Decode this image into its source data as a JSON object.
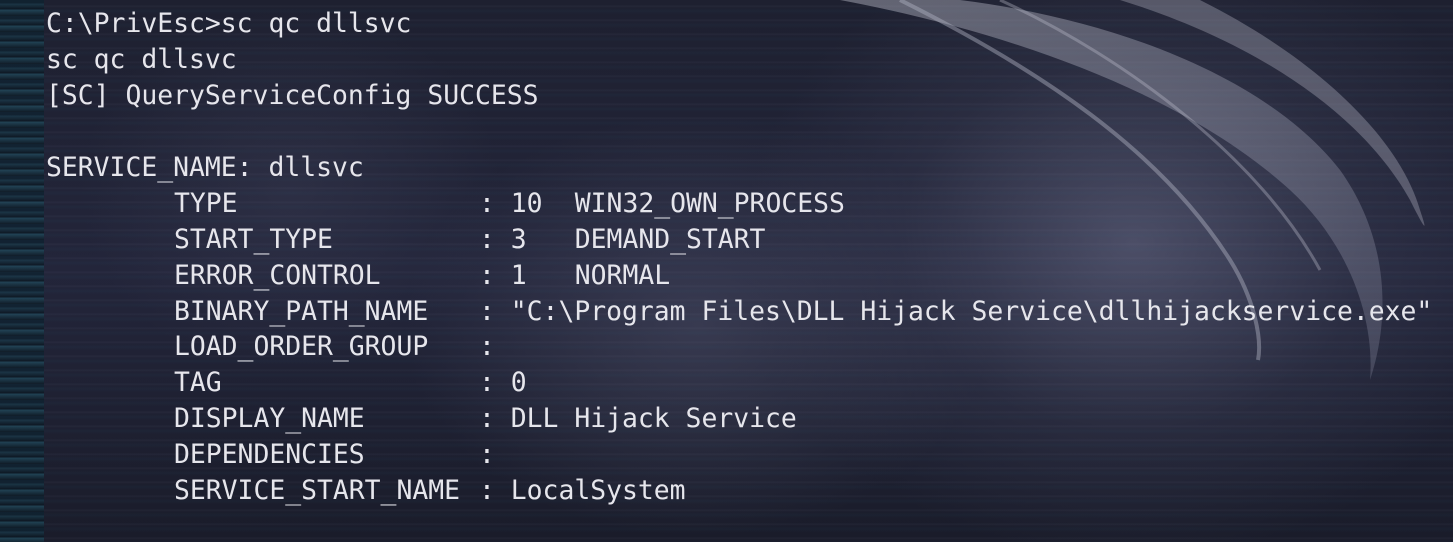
{
  "terminal": {
    "prompt_command": "C:\\PrivEsc>sc qc dllsvc",
    "echo_command": "sc qc dllsvc",
    "status": "[SC] QueryServiceConfig SUCCESS",
    "service_name_label": "SERVICE_NAME:",
    "service_name_value": "dllsvc",
    "fields": [
      {
        "key": "TYPE",
        "code": "10",
        "value": "WIN32_OWN_PROCESS"
      },
      {
        "key": "START_TYPE",
        "code": "3",
        "value": "DEMAND_START"
      },
      {
        "key": "ERROR_CONTROL",
        "code": "1",
        "value": "NORMAL"
      },
      {
        "key": "BINARY_PATH_NAME",
        "code": "",
        "value": "\"C:\\Program Files\\DLL Hijack Service\\dllhijackservice.exe\""
      },
      {
        "key": "LOAD_ORDER_GROUP",
        "code": "",
        "value": ""
      },
      {
        "key": "TAG",
        "code": "0",
        "value": ""
      },
      {
        "key": "DISPLAY_NAME",
        "code": "",
        "value": "DLL Hijack Service"
      },
      {
        "key": "DEPENDENCIES",
        "code": "",
        "value": ""
      },
      {
        "key": "SERVICE_START_NAME",
        "code": "",
        "value": "LocalSystem"
      }
    ],
    "separator": ": ",
    "colors": {
      "text": "#e6e6ec",
      "background": "#1b1d2b"
    }
  }
}
